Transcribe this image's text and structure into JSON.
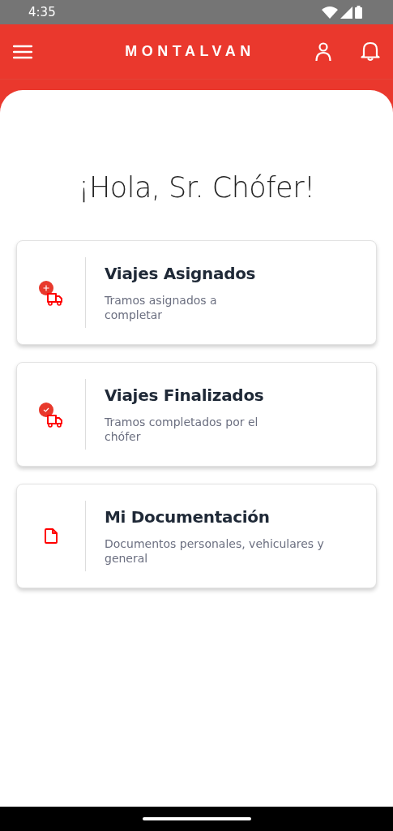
{
  "status_bar": {
    "time": "4:35"
  },
  "app_bar": {
    "title": "MONTALVAN"
  },
  "greeting": "¡Hola, Sr. Chófer!",
  "cards": [
    {
      "kind": "truck-plus",
      "title": "Viajes Asignados",
      "description": "Tramos asignados a\ncompletar"
    },
    {
      "kind": "truck-check",
      "title": "Viajes Finalizados",
      "description": "Tramos completados por el\nchófer"
    },
    {
      "kind": "document",
      "title": "Mi Documentación",
      "description": "Documentos personales, vehiculares y\ngeneral"
    }
  ]
}
